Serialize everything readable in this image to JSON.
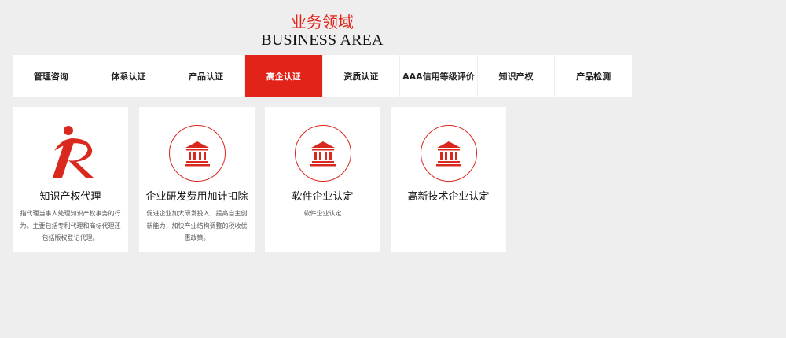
{
  "header": {
    "title_cn": "业务领域",
    "title_en": "BUSINESS AREA"
  },
  "tabs": [
    {
      "label": "管理咨询",
      "active": false
    },
    {
      "label": "体系认证",
      "active": false
    },
    {
      "label": "产品认证",
      "active": false
    },
    {
      "label": "高企认证",
      "active": true
    },
    {
      "label": "资质认证",
      "active": false
    },
    {
      "label": "AAA信用等级评价",
      "active": false
    },
    {
      "label": "知识产权",
      "active": false
    },
    {
      "label": "产品检测",
      "active": false
    }
  ],
  "cards": [
    {
      "icon": "ip-logo-icon",
      "title": "知识产权代理",
      "desc": "指代理当事人处理知识产权事务的行为。主要包括专利代理和商标代理还包括版权登记代理。"
    },
    {
      "icon": "institution-building-icon",
      "title": "企业研发费用加计扣除",
      "desc": "促进企业加大研发投入，提高自主创新能力，加快产业结构调整的税收优惠政策。"
    },
    {
      "icon": "institution-building-icon",
      "title": "软件企业认定",
      "desc": "软件企业认定"
    },
    {
      "icon": "institution-building-icon",
      "title": "高新技术企业认定",
      "desc": ""
    }
  ],
  "colors": {
    "accent": "#e2231a",
    "background": "#eeeeee",
    "card": "#ffffff"
  }
}
